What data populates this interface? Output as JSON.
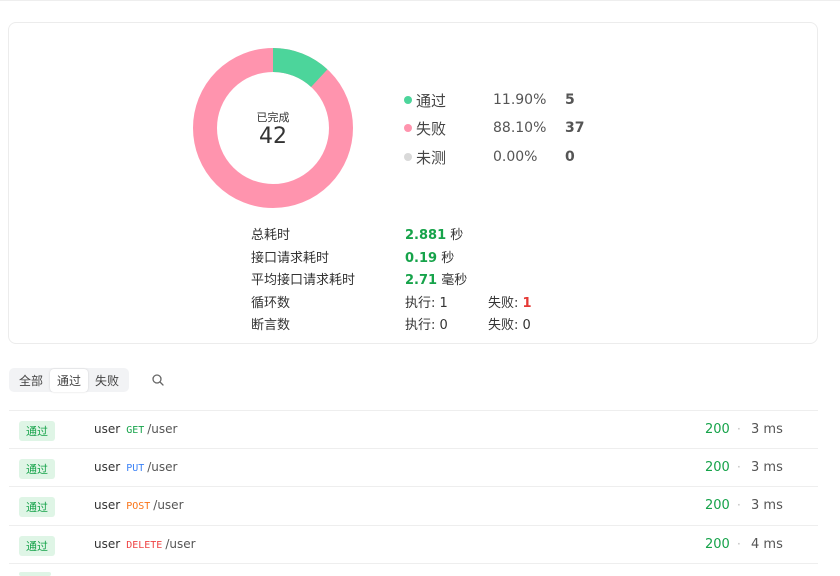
{
  "summary": {
    "completed_label": "已完成",
    "completed_value": "42",
    "legend": [
      {
        "name": "通过",
        "pct": "11.90%",
        "count": "5",
        "color": "#4cd59b"
      },
      {
        "name": "失败",
        "pct": "88.10%",
        "count": "37",
        "color": "#ff94ae"
      },
      {
        "name": "未测",
        "pct": "0.00%",
        "count": "0",
        "color": "#d9d9d9"
      }
    ],
    "stats": {
      "total_time_label": "总耗时",
      "total_time_value": "2.881",
      "total_time_unit": "秒",
      "request_time_label": "接口请求耗时",
      "request_time_value": "0.19",
      "request_time_unit": "秒",
      "avg_time_label": "平均接口请求耗时",
      "avg_time_value": "2.71",
      "avg_time_unit": "毫秒",
      "loop_label": "循环数",
      "loop_exec": "执行: 1",
      "loop_fail_label": "失败: ",
      "loop_fail_value": "1",
      "assert_label": "断言数",
      "assert_exec": "执行: 0",
      "assert_fail": "失败: 0"
    }
  },
  "filters": {
    "tabs": [
      "全部",
      "通过",
      "失败"
    ],
    "active": "通过",
    "search_icon": "search-icon"
  },
  "results": [
    {
      "status": "通过",
      "name": "user",
      "method": "GET",
      "method_color": "#16a34a",
      "path": "/user",
      "code": "200",
      "dot": "·",
      "time": "3 ms"
    },
    {
      "status": "通过",
      "name": "user",
      "method": "PUT",
      "method_color": "#3b82f6",
      "path": "/user",
      "code": "200",
      "dot": "·",
      "time": "3 ms"
    },
    {
      "status": "通过",
      "name": "user",
      "method": "POST",
      "method_color": "#f97316",
      "path": "/user",
      "code": "200",
      "dot": "·",
      "time": "3 ms"
    },
    {
      "status": "通过",
      "name": "user",
      "method": "DELETE",
      "method_color": "#ef4444",
      "path": "/user",
      "code": "200",
      "dot": "·",
      "time": "4 ms"
    }
  ]
}
